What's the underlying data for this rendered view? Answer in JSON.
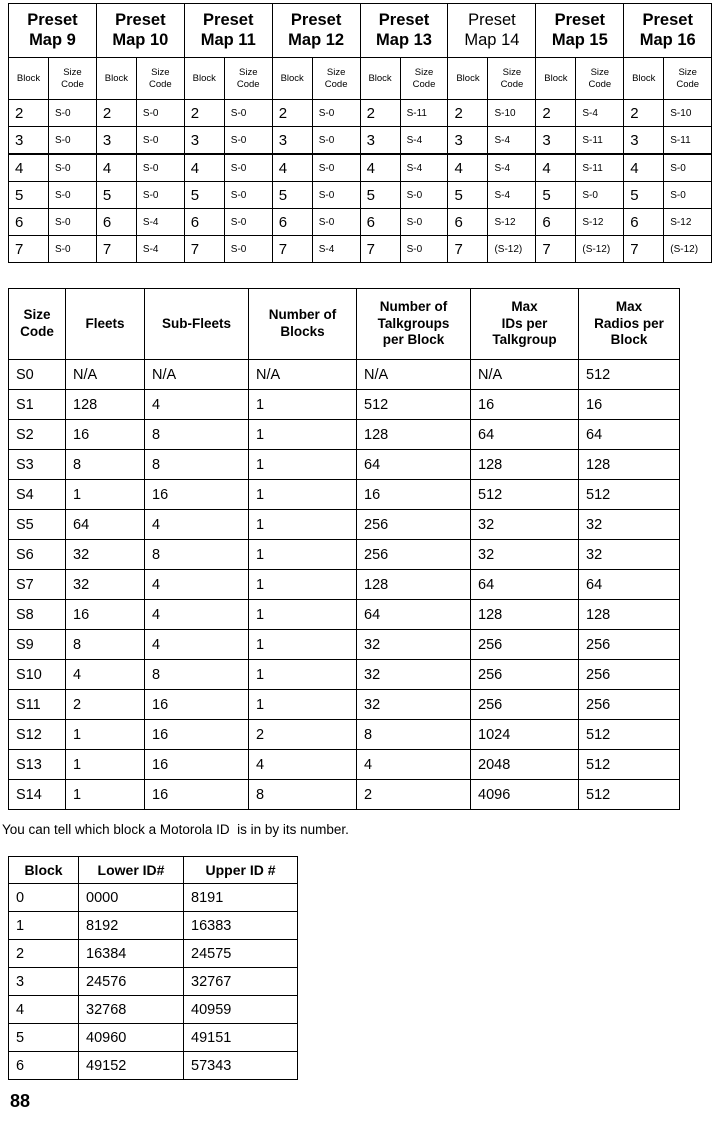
{
  "preset_table": {
    "map_headers": [
      {
        "line1": "Preset",
        "line2": "Map 9",
        "bold": true
      },
      {
        "line1": "Preset",
        "line2": "Map 10",
        "bold": true
      },
      {
        "line1": "Preset",
        "line2": "Map 11",
        "bold": true
      },
      {
        "line1": "Preset",
        "line2": "Map 12",
        "bold": true
      },
      {
        "line1": "Preset",
        "line2": "Map 13",
        "bold": true
      },
      {
        "line1": "Preset",
        "line2": "Map 14",
        "bold": false
      },
      {
        "line1": "Preset",
        "line2": "Map 15",
        "bold": true
      },
      {
        "line1": "Preset",
        "line2": "Map 16",
        "bold": true
      }
    ],
    "sub_headers": {
      "block": "Block",
      "size_code_line1": "Size",
      "size_code_line2": "Code"
    },
    "rows": [
      {
        "block": "2",
        "codes": [
          "S-0",
          "S-0",
          "S-0",
          "S-0",
          "S-11",
          "S-10",
          "S-4",
          "S-10"
        ]
      },
      {
        "block": "3",
        "codes": [
          "S-0",
          "S-0",
          "S-0",
          "S-0",
          "S-4",
          "S-4",
          "S-11",
          "S-11"
        ]
      },
      {
        "block": "4",
        "codes": [
          "S-0",
          "S-0",
          "S-0",
          "S-0",
          "S-4",
          "S-4",
          "S-11",
          "S-0"
        ]
      },
      {
        "block": "5",
        "codes": [
          "S-0",
          "S-0",
          "S-0",
          "S-0",
          "S-0",
          "S-4",
          "S-0",
          "S-0"
        ]
      },
      {
        "block": "6",
        "codes": [
          "S-0",
          "S-4",
          "S-0",
          "S-0",
          "S-0",
          "S-12",
          "S-12",
          "S-12"
        ]
      },
      {
        "block": "7",
        "codes": [
          "S-0",
          "S-4",
          "S-0",
          "S-4",
          "S-0",
          "(S-12)",
          "(S-12)",
          "(S-12)"
        ]
      }
    ],
    "thick_rule_before_row_index": 2
  },
  "sizecode_table": {
    "headers": [
      "Size\nCode",
      "Fleets",
      "Sub-Fleets",
      "Number of\nBlocks",
      "Number of\nTalkgroups\nper Block",
      "Max\nIDs per\nTalkgroup",
      "Max\nRadios per\nBlock"
    ],
    "rows": [
      [
        "S0",
        "N/A",
        "N/A",
        "N/A",
        "N/A",
        "N/A",
        "512"
      ],
      [
        "S1",
        "128",
        "4",
        "1",
        "512",
        "16",
        "16"
      ],
      [
        "S2",
        "16",
        "8",
        "1",
        "128",
        "64",
        "64"
      ],
      [
        "S3",
        "8",
        "8",
        "1",
        "64",
        "128",
        "128"
      ],
      [
        "S4",
        "1",
        "16",
        "1",
        "16",
        "512",
        "512"
      ],
      [
        "S5",
        "64",
        "4",
        "1",
        "256",
        "32",
        "32"
      ],
      [
        "S6",
        "32",
        "8",
        "1",
        "256",
        "32",
        "32"
      ],
      [
        "S7",
        "32",
        "4",
        "1",
        "128",
        "64",
        "64"
      ],
      [
        "S8",
        "16",
        "4",
        "1",
        "64",
        "128",
        "128"
      ],
      [
        "S9",
        "8",
        "4",
        "1",
        "32",
        "256",
        "256"
      ],
      [
        "S10",
        "4",
        "8",
        "1",
        "32",
        "256",
        "256"
      ],
      [
        "S11",
        "2",
        "16",
        "1",
        "32",
        "256",
        "256"
      ],
      [
        "S12",
        "1",
        "16",
        "2",
        "8",
        "1024",
        "512"
      ],
      [
        "S13",
        "1",
        "16",
        "4",
        "4",
        "2048",
        "512"
      ],
      [
        "S14",
        "1",
        "16",
        "8",
        "2",
        "4096",
        "512"
      ]
    ]
  },
  "note": {
    "text": "You can tell which block a Motorola ID  is in by its number."
  },
  "blockid_table": {
    "headers": [
      "Block",
      "Lower ID#",
      "Upper ID #"
    ],
    "rows": [
      [
        "0",
        "0000",
        "8191"
      ],
      [
        "1",
        "8192",
        "16383"
      ],
      [
        "2",
        "16384",
        "24575"
      ],
      [
        "3",
        "24576",
        "32767"
      ],
      [
        "4",
        "32768",
        "40959"
      ],
      [
        "5",
        "40960",
        "49151"
      ],
      [
        "6",
        "49152",
        "57343"
      ]
    ]
  },
  "page": {
    "number": "88"
  }
}
